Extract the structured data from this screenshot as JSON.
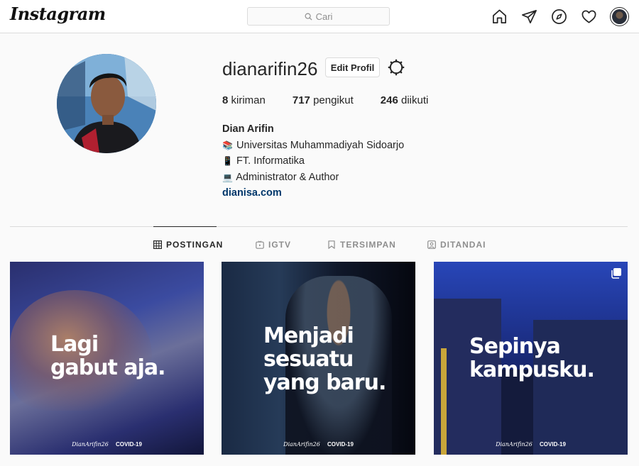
{
  "app": {
    "logo_text": "Instagram"
  },
  "search": {
    "placeholder": "Cari"
  },
  "nav": {
    "icons": [
      "home-icon",
      "direct-icon",
      "explore-icon",
      "activity-heart-icon",
      "profile-avatar"
    ]
  },
  "profile": {
    "username": "dianarifin26",
    "edit_label": "Edit Profil",
    "stats": {
      "posts_count": "8",
      "posts_label": "kiriman",
      "followers_count": "717",
      "followers_label": "pengikut",
      "following_count": "246",
      "following_label": "diikuti"
    },
    "bio": {
      "name": "Dian Arifin",
      "line1": "Universitas Muhammadiyah Sidoarjo",
      "line2": "FT. Informatika",
      "line3": "Administrator & Author",
      "website": "dianisa.com"
    }
  },
  "tabs": [
    {
      "label": "POSTINGAN",
      "active": true
    },
    {
      "label": "IGTV",
      "active": false
    },
    {
      "label": "TERSIMPAN",
      "active": false
    },
    {
      "label": "DITANDAI",
      "active": false
    }
  ],
  "posts": [
    {
      "caption_1": "Lagi",
      "caption_2": "gabut aja.",
      "caption_3": "",
      "signature": "DianArifin26",
      "tag": "COVID-19"
    },
    {
      "caption_1": "Menjadi",
      "caption_2": "sesuatu",
      "caption_3": "yang baru.",
      "signature": "DianArifin26",
      "tag": "COVID-19"
    },
    {
      "caption_1": "Sepinya",
      "caption_2": "kampusku.",
      "caption_3": "",
      "signature": "DianArifin26",
      "tag": "COVID-19"
    }
  ],
  "colors": {
    "link": "#00376b",
    "border": "#dbdbdb",
    "text": "#262626",
    "muted": "#8e8e8e"
  }
}
